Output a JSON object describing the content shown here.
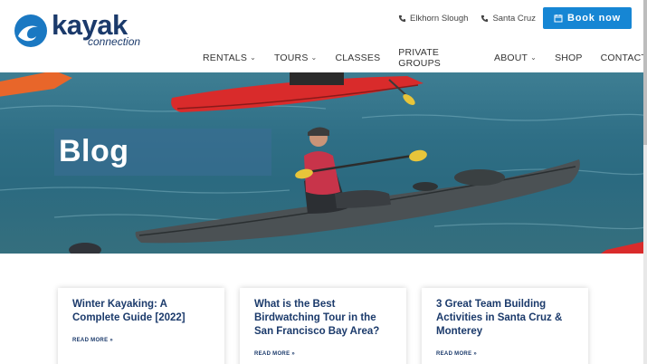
{
  "header": {
    "logo": {
      "word": "kayak",
      "sub": "connection"
    },
    "top_links": [
      {
        "label": "Elkhorn Slough",
        "icon": "phone-icon"
      },
      {
        "label": "Santa Cruz",
        "icon": "phone-icon"
      }
    ],
    "book_button": {
      "label": "Book now",
      "icon": "calendar-icon"
    },
    "nav": [
      {
        "label": "RENTALS",
        "dropdown": true
      },
      {
        "label": "TOURS",
        "dropdown": true
      },
      {
        "label": "CLASSES",
        "dropdown": false
      },
      {
        "label": "PRIVATE GROUPS",
        "dropdown": false
      },
      {
        "label": "ABOUT",
        "dropdown": true
      },
      {
        "label": "SHOP",
        "dropdown": false
      },
      {
        "label": "CONTACT",
        "dropdown": false
      }
    ],
    "dropdown_glyph": "⌄"
  },
  "hero": {
    "title": "Blog"
  },
  "posts": [
    {
      "title": "Winter Kayaking: A Complete Guide [2022]",
      "read_more": "READ MORE »"
    },
    {
      "title": "What is the Best Birdwatching Tour in the San Francisco Bay Area?",
      "read_more": "READ MORE »"
    },
    {
      "title": "3 Great Team Building Activities in Santa Cruz & Monterey",
      "read_more": "READ MORE »"
    }
  ],
  "colors": {
    "brand_navy": "#1b3a6b",
    "brand_blue": "#1686d4",
    "water": "#2f6f86"
  }
}
